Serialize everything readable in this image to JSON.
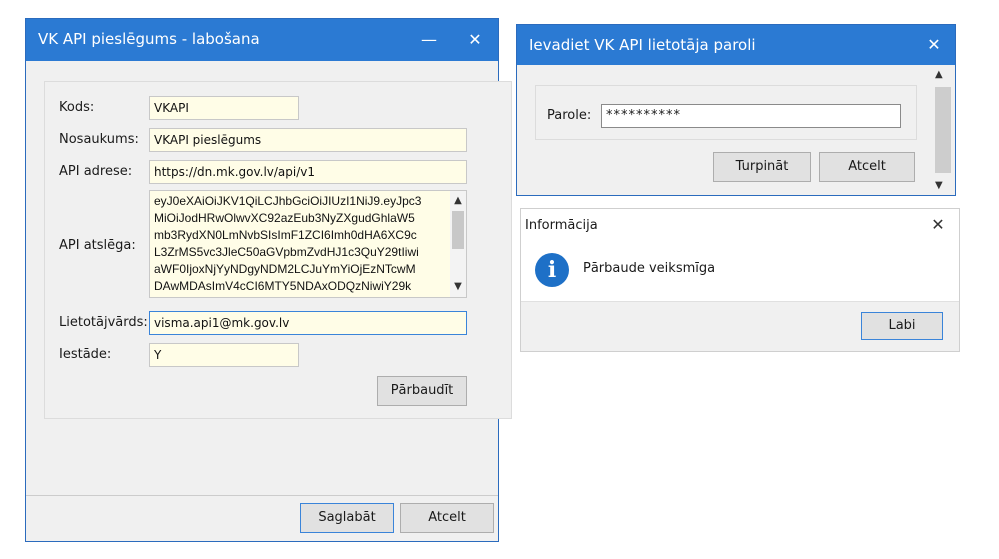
{
  "edit_window": {
    "title": "VK API pieslēgums - labošana",
    "minimize_label": "—",
    "close_label": "✕",
    "labels": {
      "kods": "Kods:",
      "nosaukums": "Nosaukums:",
      "api_adrese": "API adrese:",
      "api_atslega": "API atslēga:",
      "lietotajvards": "Lietotājvārds:",
      "iestade": "Iestāde:"
    },
    "values": {
      "kods": "VKAPI",
      "nosaukums": "VKAPI pieslēgums",
      "api_adrese": "https://dn.mk.gov.lv/api/v1",
      "lietotajvards": "visma.api1@mk.gov.lv",
      "iestade": "Y"
    },
    "api_key_lines": [
      "eyJ0eXAiOiJKV1QiLCJhbGciOiJIUzI1NiJ9.eyJpc3",
      "MiOiJodHRwOlwvXC92azEub3NyZXgudGhlaW5",
      "mb3RydXN0LmNvbSIsImF1ZCI6Imh0dHA6XC9c",
      "L3ZrMS5vc3JleC50aGVpbmZvdHJ1c3QuY29tIiwi",
      "aWF0IjoxNjYyNDgyNDM2LCJuYmYiOjEzNTcwM",
      "DAwMDAsImV4cCI6MTY5NDAxODQzNiwiY29k"
    ],
    "buttons": {
      "parbaudit": "Pārbaudīt",
      "saglabat": "Saglabāt",
      "atcelt": "Atcelt"
    }
  },
  "password_window": {
    "title": "Ievadiet VK API lietotāja paroli",
    "close_label": "✕",
    "label": "Parole:",
    "value": "**********",
    "buttons": {
      "turpinat": "Turpināt",
      "atcelt": "Atcelt"
    }
  },
  "info_window": {
    "title": "Informācija",
    "close_label": "✕",
    "icon_glyph": "i",
    "message": "Pārbaude veiksmīga",
    "button": "Labi"
  },
  "colors": {
    "title_bar": "#2b7ad3",
    "field_bg": "#fffde7",
    "focus_border": "#3a84d9",
    "info_icon": "#1e70c7"
  }
}
